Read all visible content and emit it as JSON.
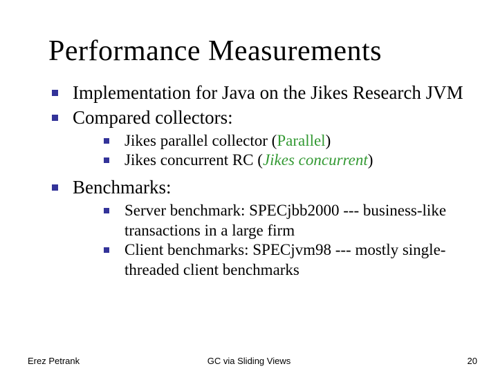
{
  "title": "Performance Measurements",
  "bullets": {
    "l1_0": "Implementation for Java on the Jikes Research JVM",
    "l1_1": "Compared collectors:",
    "l2_0_pre": "Jikes parallel collector (",
    "l2_0_em": "Parallel",
    "l2_0_post": ")",
    "l2_1_pre": "Jikes concurrent RC (",
    "l2_1_em": "Jikes concurrent",
    "l2_1_post": ")",
    "l1_2": "Benchmarks:",
    "l2_2": "Server benchmark:  SPECjbb2000 --- business-like transactions in a large firm",
    "l2_3": "Client benchmarks:  SPECjvm98 --- mostly single-threaded client benchmarks"
  },
  "footer": {
    "left": "Erez Petrank",
    "center": "GC via Sliding Views",
    "right": "20"
  }
}
